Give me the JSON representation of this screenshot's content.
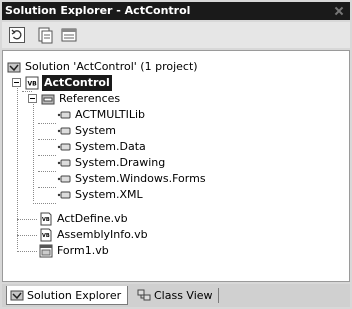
{
  "window": {
    "title": "Solution Explorer - ActControl"
  },
  "toolbar": {
    "buttons": [
      {
        "icon": "refresh-icon"
      },
      {
        "icon": "show-all-files-icon"
      },
      {
        "icon": "properties-icon"
      }
    ]
  },
  "tree": {
    "solution": "Solution 'ActControl' (1 project)",
    "project": "ActControl",
    "references_label": "References",
    "references": [
      "ACTMULTILib",
      "System",
      "System.Data",
      "System.Drawing",
      "System.Windows.Forms",
      "System.XML"
    ],
    "files": [
      {
        "name": "ActDefine.vb",
        "icon": "vb-file-icon"
      },
      {
        "name": "AssemblyInfo.vb",
        "icon": "vb-file-icon"
      },
      {
        "name": "Form1.vb",
        "icon": "form-file-icon"
      }
    ]
  },
  "tabs": [
    {
      "label": "Solution Explorer",
      "icon": "solution-explorer-icon",
      "active": true
    },
    {
      "label": "Class View",
      "icon": "class-view-icon",
      "active": false
    }
  ]
}
